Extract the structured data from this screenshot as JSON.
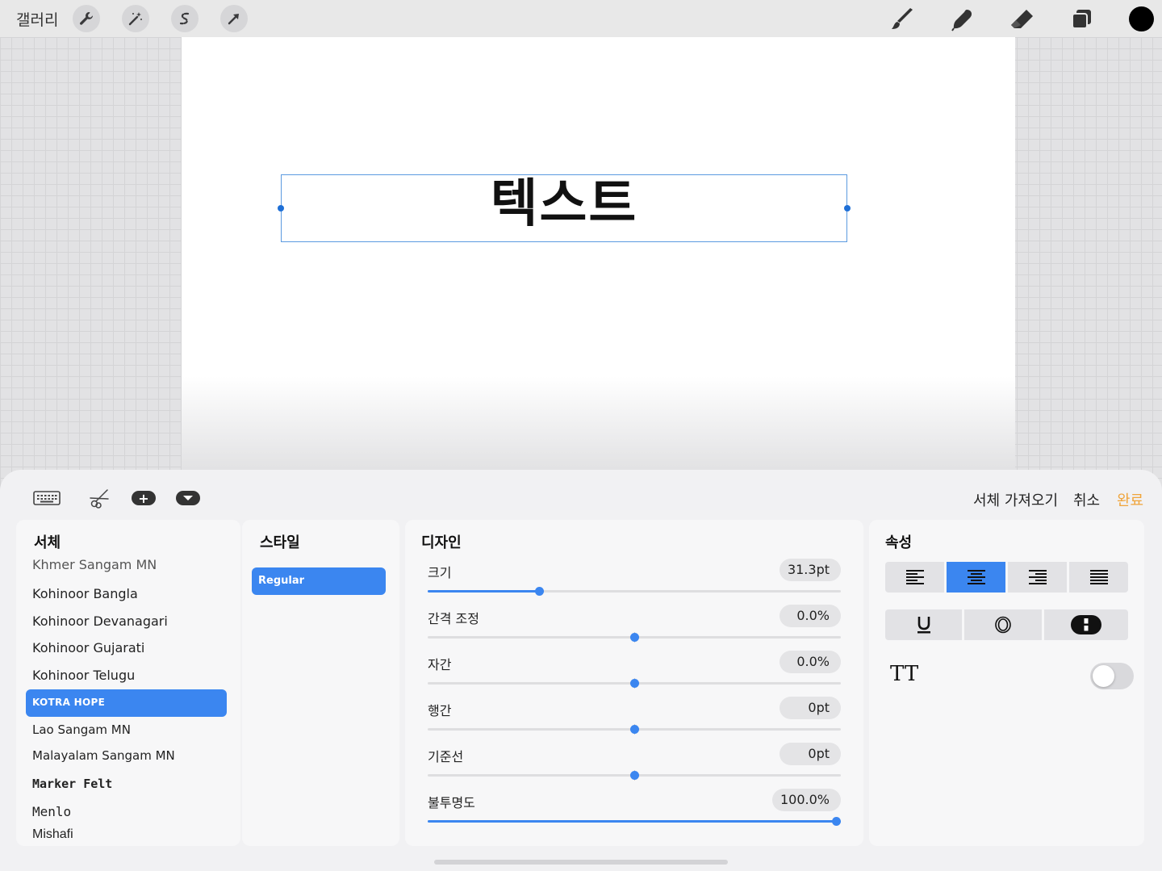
{
  "topbar": {
    "gallery_label": "갤러리",
    "left_tools": [
      "wrench-icon",
      "magic-wand-icon",
      "selection-s-icon",
      "transform-arrow-icon"
    ],
    "right_tools": [
      "brush-icon",
      "smudge-icon",
      "eraser-icon",
      "layers-icon"
    ],
    "current_color": "#000000"
  },
  "canvas": {
    "text": "텍스트"
  },
  "panel": {
    "tools": [
      "keyboard-icon",
      "scissors-icon",
      "add-icon",
      "collapse-icon"
    ],
    "import_font_label": "서체 가져오기",
    "cancel_label": "취소",
    "done_label": "완료",
    "accent_color": "#3b86f0",
    "done_color": "#f0a43a"
  },
  "fonts": {
    "title": "서체",
    "items": [
      "Khmer Sangam MN",
      "Kohinoor Bangla",
      "Kohinoor Devanagari",
      "Kohinoor Gujarati",
      "Kohinoor Telugu",
      "KOTRA HOPE",
      "Lao Sangam MN",
      "Malayalam Sangam MN",
      "Marker Felt",
      "Menlo",
      "Mishafi"
    ],
    "selected": "KOTRA HOPE"
  },
  "style": {
    "title": "스타일",
    "selected": "Regular"
  },
  "design": {
    "title": "디자인",
    "sliders": [
      {
        "label": "크기",
        "value": "31.3pt",
        "level": 0.27,
        "centered": false
      },
      {
        "label": "간격 조정",
        "value": "0.0%",
        "level": 0.5,
        "centered": true
      },
      {
        "label": "자간",
        "value": "0.0%",
        "level": 0.5,
        "centered": true
      },
      {
        "label": "행간",
        "value": "0pt",
        "level": 0.5,
        "centered": true
      },
      {
        "label": "기준선",
        "value": "0pt",
        "level": 0.5,
        "centered": true
      },
      {
        "label": "불투명도",
        "value": "100.0%",
        "level": 1.0,
        "centered": false
      }
    ]
  },
  "attributes": {
    "title": "속성",
    "alignment_options": [
      "align-left-icon",
      "align-center-icon",
      "align-right-icon",
      "align-justify-icon"
    ],
    "alignment_selected": "align-center-icon",
    "format_options": [
      "underline-icon",
      "outline-icon",
      "background-icon"
    ],
    "all_caps_label": "TT",
    "all_caps_on": false
  }
}
